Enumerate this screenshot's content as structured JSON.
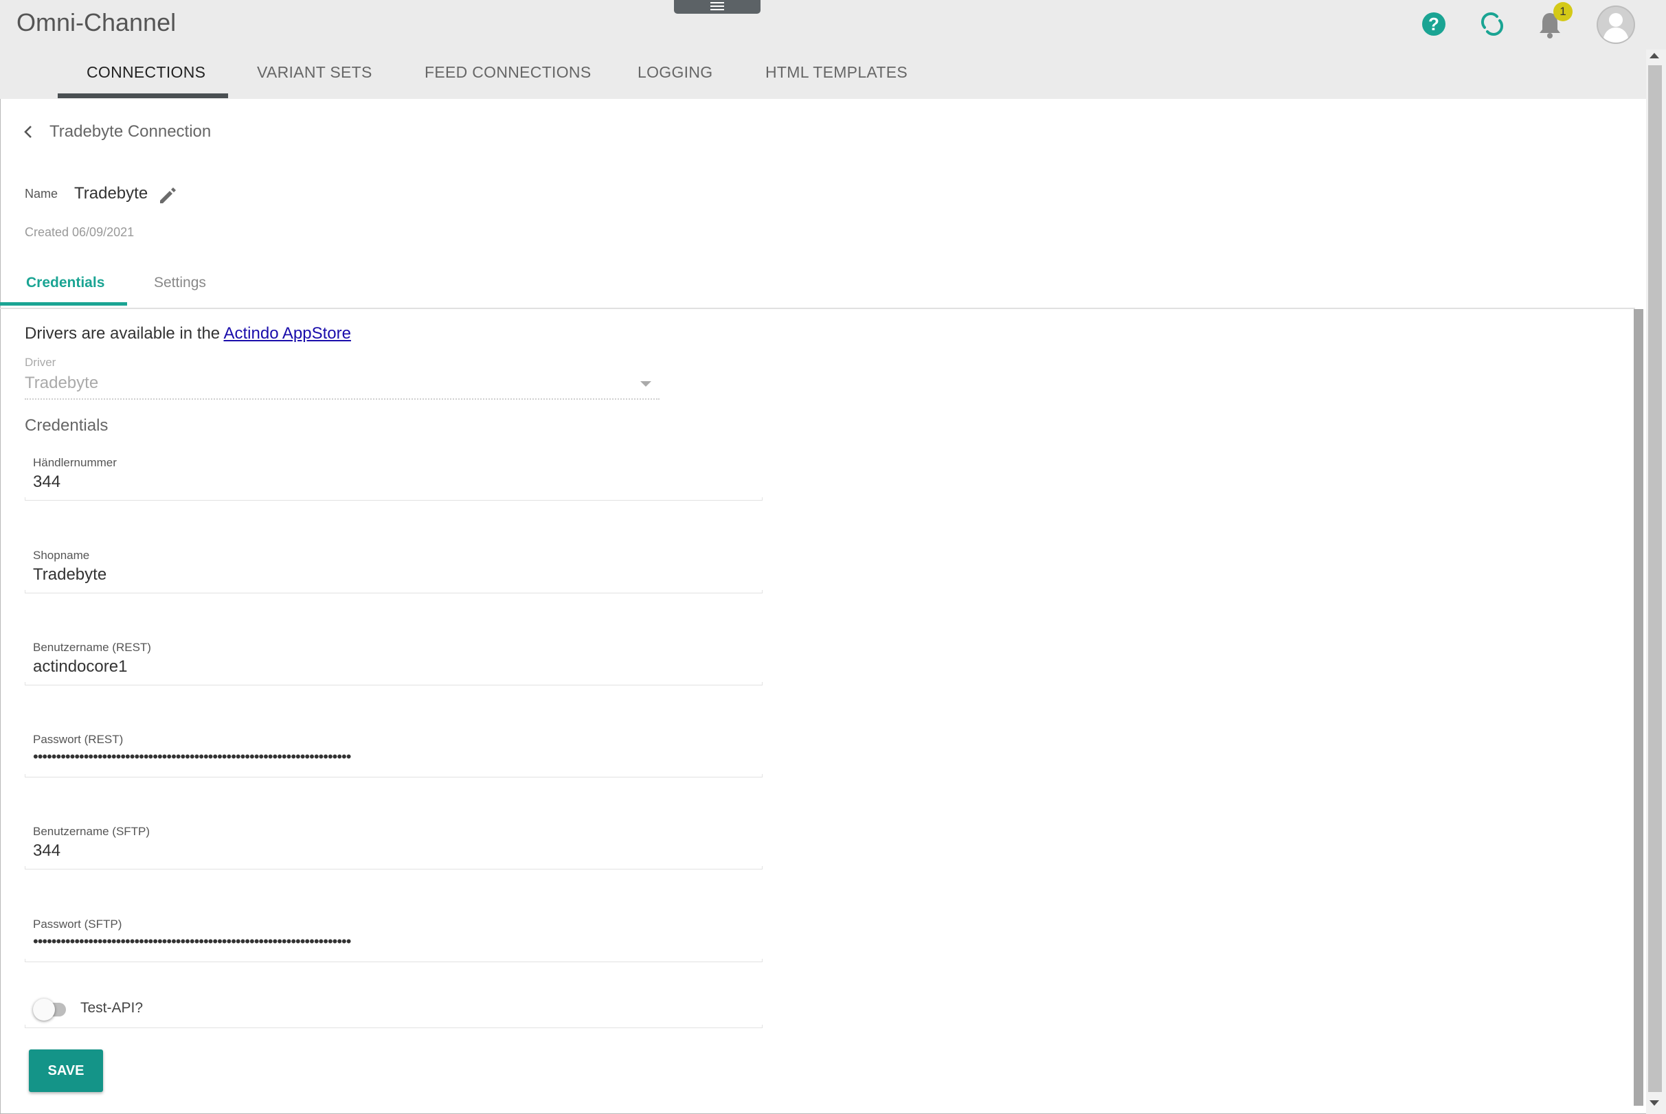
{
  "app": {
    "title": "Omni-Channel"
  },
  "header": {
    "notification_count": "1",
    "help_icon": "help-icon",
    "sync_icon": "sync-icon",
    "bell_icon": "bell-icon",
    "avatar_icon": "user-avatar-icon"
  },
  "nav": {
    "tabs": [
      {
        "label": "CONNECTIONS",
        "active": true
      },
      {
        "label": "VARIANT SETS",
        "active": false
      },
      {
        "label": "FEED CONNECTIONS",
        "active": false
      },
      {
        "label": "LOGGING",
        "active": false
      },
      {
        "label": "HTML TEMPLATES",
        "active": false
      }
    ]
  },
  "page": {
    "title": "Tradebyte Connection",
    "name_label": "Name",
    "name_value": "Tradebyte",
    "created": "Created 06/09/2021"
  },
  "subtabs": [
    {
      "label": "Credentials",
      "active": true
    },
    {
      "label": "Settings",
      "active": false
    }
  ],
  "credentials": {
    "drivers_text": "Drivers are available in the",
    "drivers_link": "Actindo AppStore",
    "driver_label": "Driver",
    "driver_value": "Tradebyte",
    "section_title": "Credentials",
    "fields": [
      {
        "label": "Händlernummer",
        "value": "344"
      },
      {
        "label": "Shopname",
        "value": "Tradebyte"
      },
      {
        "label": "Benutzername (REST)",
        "value": "actindocore1"
      },
      {
        "label": "Passwort (REST)",
        "value": "•••••••••••••••••••••••••••••••••••••••••••••••••••••••••••••••••••••"
      },
      {
        "label": "Benutzername (SFTP)",
        "value": "344"
      },
      {
        "label": "Passwort (SFTP)",
        "value": "•••••••••••••••••••••••••••••••••••••••••••••••••••••••••••••••••••••"
      }
    ],
    "toggle_label": "Test-API?",
    "toggle_on": false,
    "save_label": "SAVE"
  },
  "colors": {
    "accent": "#1aa493",
    "button": "#149488",
    "badge": "#d4c917",
    "header_bg": "#ebebeb"
  }
}
